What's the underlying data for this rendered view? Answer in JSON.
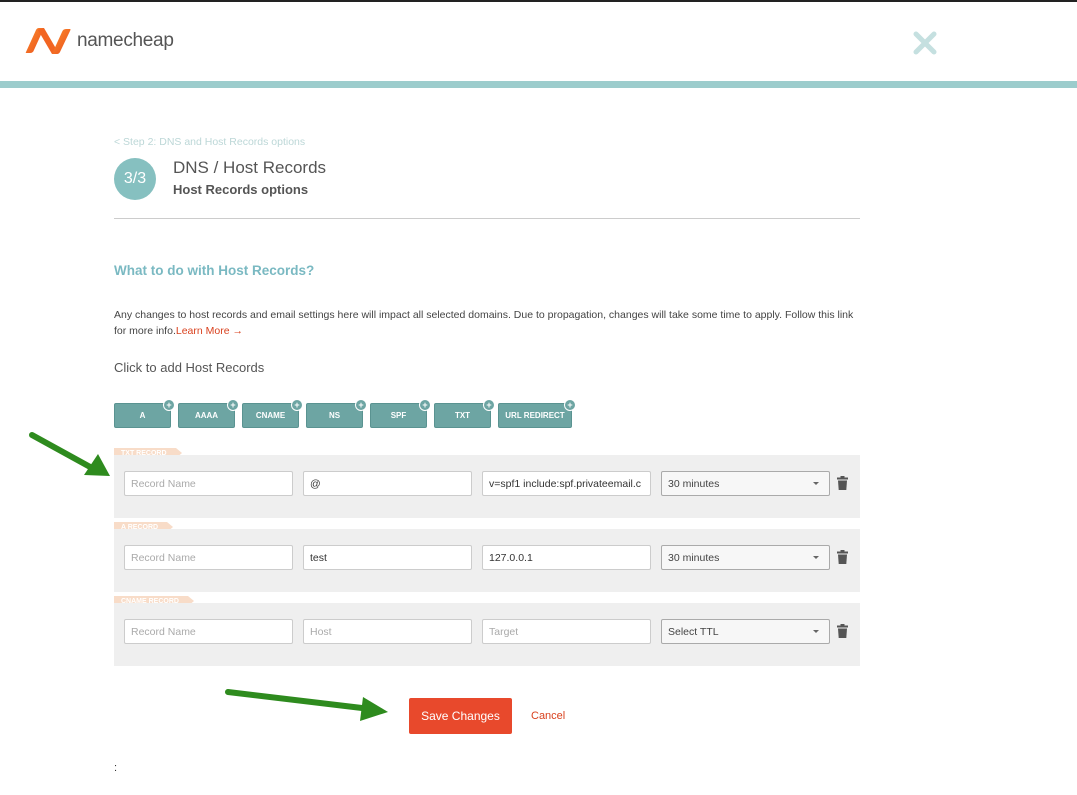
{
  "header": {
    "brand": "namecheap",
    "colors": {
      "brand_orange": "#f26522",
      "teal_bar": "#9ccccc",
      "close_icon": "#c5e0e0"
    }
  },
  "wizard": {
    "back_link": "< Step 2: DNS and Host Records options",
    "step": "3/3",
    "title": "DNS / Host Records",
    "subtitle": "Host Records options"
  },
  "content": {
    "heading": "What to do with Host Records?",
    "info": "Any changes to host records and email settings here will impact all selected domains. Due to propagation, changes will take some time to apply. Follow this link for more info.",
    "learn_more": "Learn More →",
    "add_label": "Click to add Host Records"
  },
  "record_types": [
    {
      "label": "A"
    },
    {
      "label": "AAAA"
    },
    {
      "label": "CNAME"
    },
    {
      "label": "NS"
    },
    {
      "label": "SPF"
    },
    {
      "label": "TXT"
    },
    {
      "label": "URL REDIRECT"
    }
  ],
  "records": [
    {
      "tag": "TXT RECORD",
      "name": {
        "value": "",
        "placeholder": "Record Name"
      },
      "host": {
        "value": "@",
        "placeholder": ""
      },
      "target": {
        "value": "v=spf1 include:spf.privateemail.c",
        "placeholder": ""
      },
      "ttl": "30 minutes"
    },
    {
      "tag": "A RECORD",
      "name": {
        "value": "",
        "placeholder": "Record Name"
      },
      "host": {
        "value": "test",
        "placeholder": ""
      },
      "target": {
        "value": "127.0.0.1",
        "placeholder": ""
      },
      "ttl": "30 minutes"
    },
    {
      "tag": "CNAME RECORD",
      "name": {
        "value": "",
        "placeholder": "Record Name"
      },
      "host": {
        "value": "",
        "placeholder": "Host"
      },
      "target": {
        "value": "",
        "placeholder": "Target"
      },
      "ttl": "Select TTL"
    }
  ],
  "actions": {
    "save": "Save Changes",
    "cancel": "Cancel",
    "save_color": "#e8492c"
  },
  "footer": {
    "stray": ":"
  },
  "annotations": {
    "arrow_color": "#2e8b1e"
  }
}
